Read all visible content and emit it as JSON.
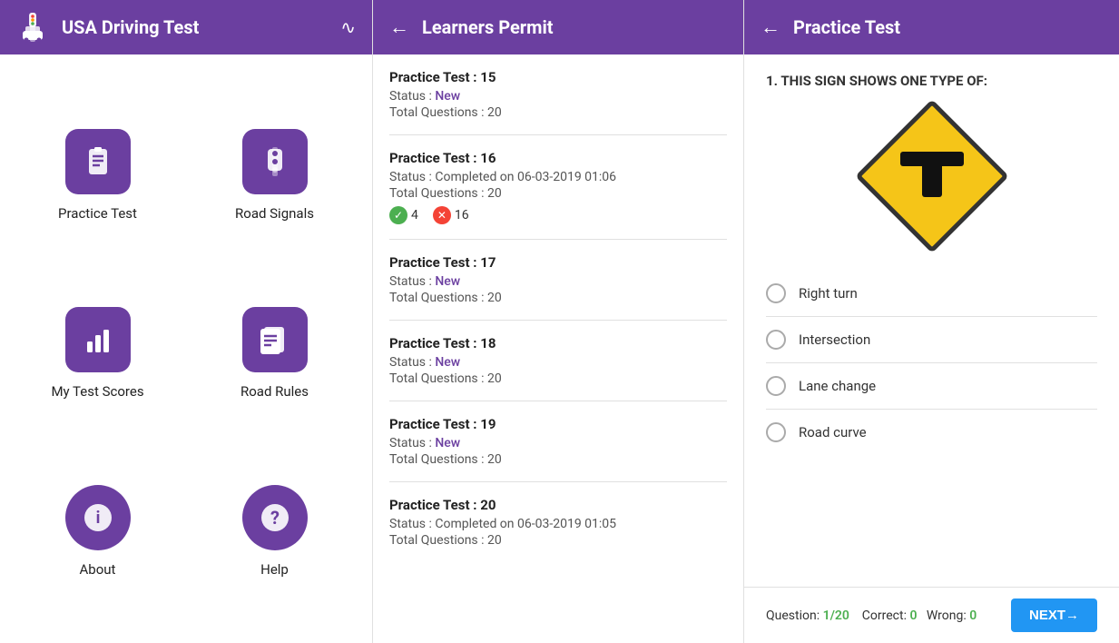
{
  "app": {
    "title": "USA Driving Test",
    "share_label": "⮁"
  },
  "menu": {
    "items": [
      {
        "id": "practice-test",
        "label": "Practice Test",
        "icon": "clipboard"
      },
      {
        "id": "road-signals",
        "label": "Road Signals",
        "icon": "traffic-light"
      },
      {
        "id": "my-test-scores",
        "label": "My Test Scores",
        "icon": "bar-chart"
      },
      {
        "id": "road-rules",
        "label": "Road Rules",
        "icon": "document"
      },
      {
        "id": "about",
        "label": "About",
        "icon": "info"
      },
      {
        "id": "help",
        "label": "Help",
        "icon": "question"
      }
    ]
  },
  "middle_panel": {
    "title": "Learners Permit",
    "back_label": "←",
    "tests": [
      {
        "id": 14,
        "name": "Practice Test : 15",
        "status_label": "Status : ",
        "status": "New",
        "status_type": "new",
        "questions_label": "Total Questions : 20"
      },
      {
        "id": 15,
        "name": "Practice Test : 16",
        "status_label": "Status : ",
        "status": "Completed on 06-03-2019 01:06",
        "status_type": "completed",
        "questions_label": "Total Questions : 20",
        "correct": 4,
        "wrong": 16
      },
      {
        "id": 16,
        "name": "Practice Test : 17",
        "status_label": "Status : ",
        "status": "New",
        "status_type": "new",
        "questions_label": "Total Questions : 20"
      },
      {
        "id": 17,
        "name": "Practice Test : 18",
        "status_label": "Status : ",
        "status": "New",
        "status_type": "new",
        "questions_label": "Total Questions : 20"
      },
      {
        "id": 18,
        "name": "Practice Test : 19",
        "status_label": "Status : ",
        "status": "New",
        "status_type": "new",
        "questions_label": "Total Questions : 20"
      },
      {
        "id": 19,
        "name": "Practice Test : 20",
        "status_label": "Status : ",
        "status": "Completed on 06-03-2019 01:05",
        "status_type": "completed",
        "questions_label": "Total Questions : 20"
      }
    ]
  },
  "right_panel": {
    "title": "Practice Test",
    "back_label": "←",
    "question_number": "1.",
    "question_text": "THIS SIGN SHOWS ONE TYPE OF:",
    "options": [
      {
        "id": "a",
        "text": "Right turn"
      },
      {
        "id": "b",
        "text": "Intersection"
      },
      {
        "id": "c",
        "text": "Lane change"
      },
      {
        "id": "d",
        "text": "Road curve"
      }
    ],
    "progress_label": "Question:",
    "progress_value": "1/20",
    "correct_label": "Correct:",
    "correct_value": "0",
    "wrong_label": "Wrong:",
    "wrong_value": "0",
    "next_button": "NEXT→"
  }
}
